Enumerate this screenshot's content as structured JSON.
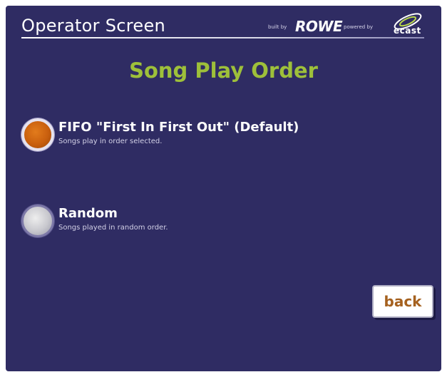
{
  "header": {
    "title": "Operator Screen",
    "built_by_label": "built by",
    "brand": "ROWE",
    "powered_by_label": "powered by",
    "ecast_brand": "ecast"
  },
  "page": {
    "title": "Song Play Order"
  },
  "options": [
    {
      "label": "FIFO \"First In First Out\" (Default)",
      "description": "Songs play in order selected.",
      "selected": true
    },
    {
      "label": "Random",
      "description": "Songs played in random order.",
      "selected": false
    }
  ],
  "actions": {
    "back_label": "back"
  },
  "colors": {
    "background": "#2f2c63",
    "title_accent": "#9ec03a",
    "selected_radio": "#d2650f",
    "unselected_radio": "#c8c8ce",
    "back_text": "#a5611f"
  },
  "icons": {
    "selected": "radio-selected-icon",
    "unselected": "radio-unselected-icon",
    "ecast": "ecast-logo-icon"
  }
}
